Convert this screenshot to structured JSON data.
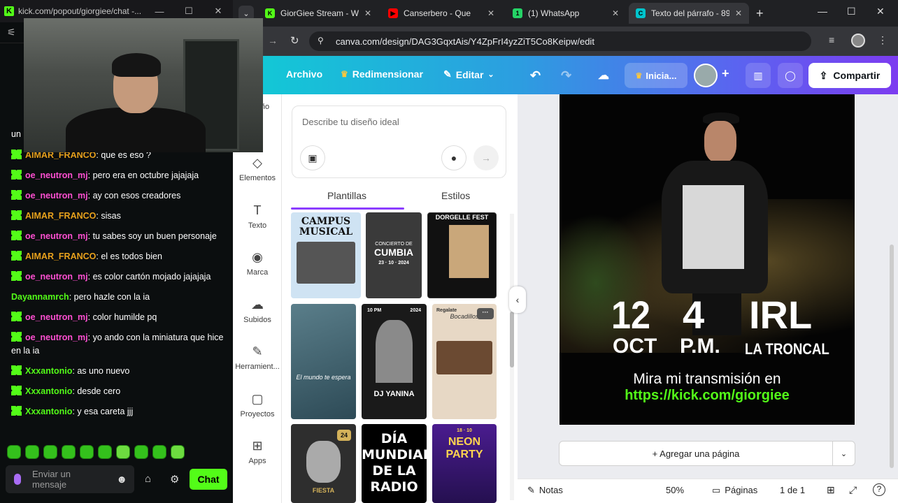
{
  "kick_window": {
    "url": "kick.com/popout/giorgiee/chat -...",
    "partial_text": "un",
    "messages": [
      {
        "user": "AIMAR_FRANCO",
        "text": "que es eso ?",
        "color": "#e8a11c"
      },
      {
        "user": "oe_neutron_mj",
        "text": "pero era en octubre jajajaja",
        "color": "#ff4fd2"
      },
      {
        "user": "oe_neutron_mj",
        "text": "ay con esos creadores",
        "color": "#ff4fd2"
      },
      {
        "user": "AIMAR_FRANCO",
        "text": "sisas",
        "color": "#e8a11c"
      },
      {
        "user": "oe_neutron_mj",
        "text": "tu sabes soy un buen personaje",
        "color": "#ff4fd2"
      },
      {
        "user": "AIMAR_FRANCO",
        "text": "el es todos bien",
        "color": "#e8a11c"
      },
      {
        "user": "oe_neutron_mj",
        "text": "es color cartón mojado jajajaja",
        "color": "#ff4fd2"
      },
      {
        "user": "Dayannamrch",
        "text": "pero hazle con la ia",
        "color": "#53fc18"
      },
      {
        "user": "oe_neutron_mj",
        "text": "color humilde pq",
        "color": "#ff4fd2"
      },
      {
        "user": "oe_neutron_mj",
        "text": "yo ando con la miniatura que hice en la ia",
        "color": "#ff4fd2"
      },
      {
        "user": "Xxxantonio",
        "text": "as uno nuevo",
        "color": "#53fc18"
      },
      {
        "user": "Xxxantonio",
        "text": "desde cero",
        "color": "#53fc18"
      },
      {
        "user": "Xxxantonio",
        "text": "y esa careta jjj",
        "color": "#53fc18"
      }
    ],
    "input_placeholder": "Enviar un mensaje",
    "chat_button": "Chat",
    "accent": "#53fc18"
  },
  "browser": {
    "tabs": [
      {
        "title": "GiorGiee Stream - Wa",
        "color": "#53fc18",
        "letter": "K"
      },
      {
        "title": "Canserbero - Que",
        "color": "#ff0000",
        "letter": "▶"
      },
      {
        "title": "(1) WhatsApp",
        "color": "#25d366",
        "letter": "1"
      },
      {
        "title": "Texto del párrafo - 89",
        "color": "#00c4cc",
        "letter": "C"
      }
    ],
    "new_tab": "+",
    "url": "canva.com/design/DAG3GqxtAis/Y4ZpFrI4yzZiT5Co8Keipw/edit"
  },
  "canva": {
    "header": {
      "archivo": "Archivo",
      "redimensionar": "Redimensionar",
      "editar": "Editar",
      "inicia": "Inicia...",
      "compartir": "Compartir"
    },
    "rail": [
      {
        "label": "Diseño",
        "icon": "layout-icon"
      },
      {
        "label": "Elementos",
        "icon": "elements-icon"
      },
      {
        "label": "Texto",
        "icon": "text-icon"
      },
      {
        "label": "Marca",
        "icon": "brand-icon"
      },
      {
        "label": "Subidos",
        "icon": "upload-icon"
      },
      {
        "label": "Herramient...",
        "icon": "tools-icon"
      },
      {
        "label": "Proyectos",
        "icon": "folder-icon"
      },
      {
        "label": "Apps",
        "icon": "apps-icon"
      }
    ],
    "ai_placeholder": "Describe tu diseño ideal",
    "panel_tabs": {
      "plantillas": "Plantillas",
      "estilos": "Estilos"
    },
    "templates": {
      "t1": "CAMPUS MUSICAL",
      "t2": "CUMBIA",
      "t2_sub": "CONCIERTO DE",
      "t2_date": "23 · 10 · 2024",
      "t3": "DORGELLE FEST",
      "t4": "El mundo te espera",
      "t5": "DJ YANINA",
      "t5_top": "10 PM",
      "t5_year": "2024",
      "t6": "Bocadillos",
      "t6_top": "Regalate",
      "t7": "FIESTA",
      "t7_badge": "24",
      "t8": "DÍA MUNDIAL DE LA RADIO",
      "t9": "NEON PARTY",
      "t9_top": "18 · 10"
    },
    "poster": {
      "big1": "12",
      "small1": "OCT",
      "big2": "4",
      "small2": "P.M.",
      "big3": "IRL",
      "small3": "LA TRONCAL",
      "line1": "Mira mi transmisión en",
      "link": "https://kick.com/giorgiee",
      "link_color": "#53fc18"
    },
    "add_page": "+ Agregar una página",
    "footer": {
      "notas": "Notas",
      "zoom": "50%",
      "paginas": "Páginas",
      "page_count": "1 de 1",
      "help": "?"
    },
    "brand_purple": "#8b3dff"
  }
}
